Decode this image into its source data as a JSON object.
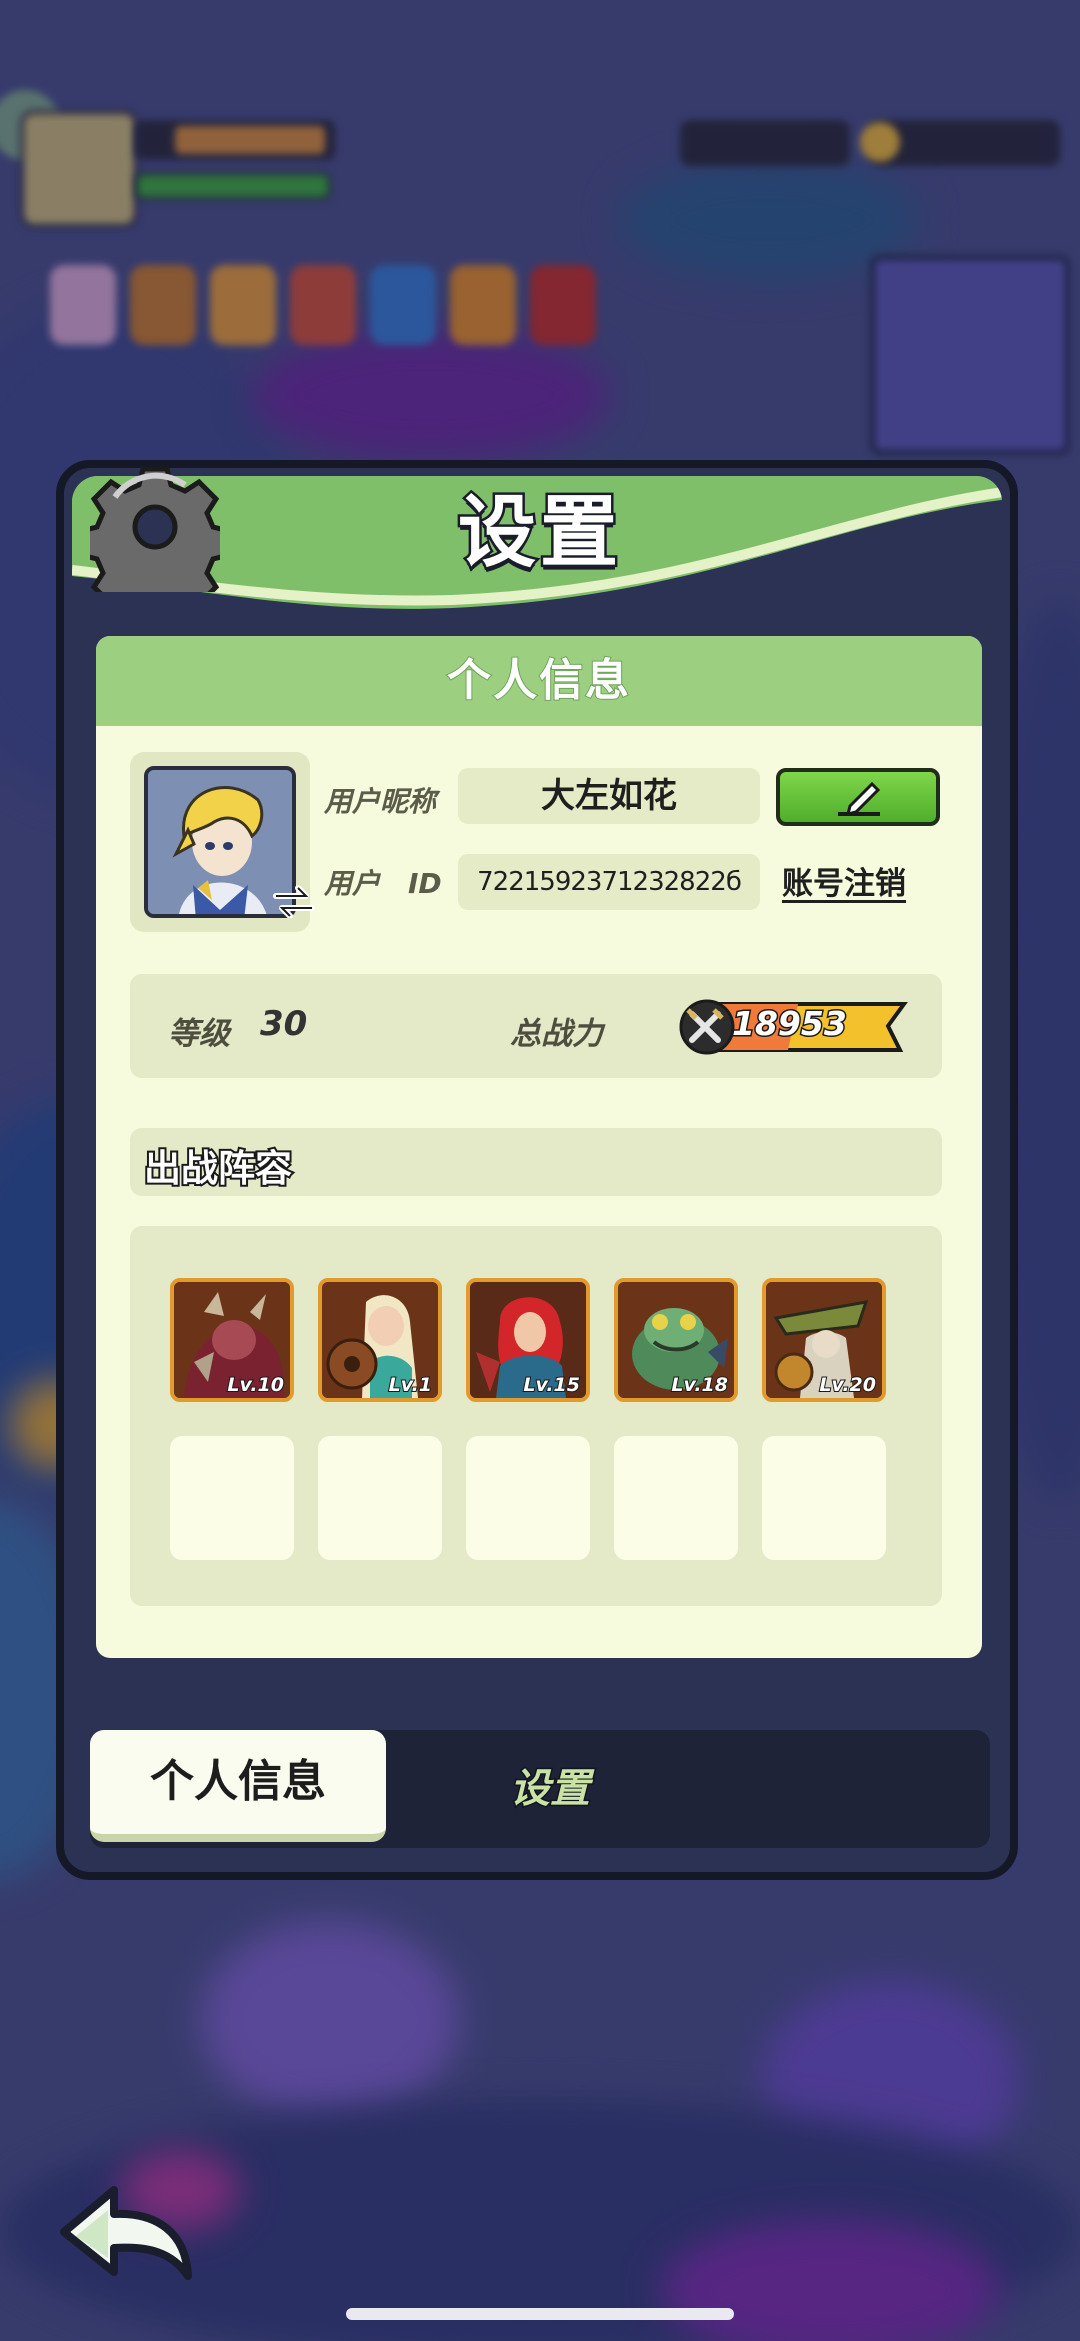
{
  "dialog": {
    "title": "设置"
  },
  "profile": {
    "section_title": "个人信息",
    "nickname_label": "用户昵称",
    "nickname_value": "大左如花",
    "id_label": "用户　ID",
    "id_value": "7221592371232822б",
    "cancel_account_label": "账号注销",
    "level_label": "等级",
    "level_value": "30",
    "power_label": "总战力",
    "power_value": "18953"
  },
  "lineup": {
    "title": "出战阵容",
    "heroes": [
      {
        "level": "Lv.10"
      },
      {
        "level": "Lv.1"
      },
      {
        "level": "Lv.15"
      },
      {
        "level": "Lv.18"
      },
      {
        "level": "Lv.20"
      }
    ]
  },
  "tabs": {
    "profile": "个人信息",
    "settings": "设置"
  },
  "colors": {
    "header_green": "#7fbf6a",
    "card_bg": "#f5fbdc",
    "hero_border": "#e29a2c",
    "edit_button": "#5cbc34"
  },
  "icons": [
    "gear-icon",
    "swap-icon",
    "pencil-icon",
    "sword-icon",
    "back-arrow-icon"
  ]
}
